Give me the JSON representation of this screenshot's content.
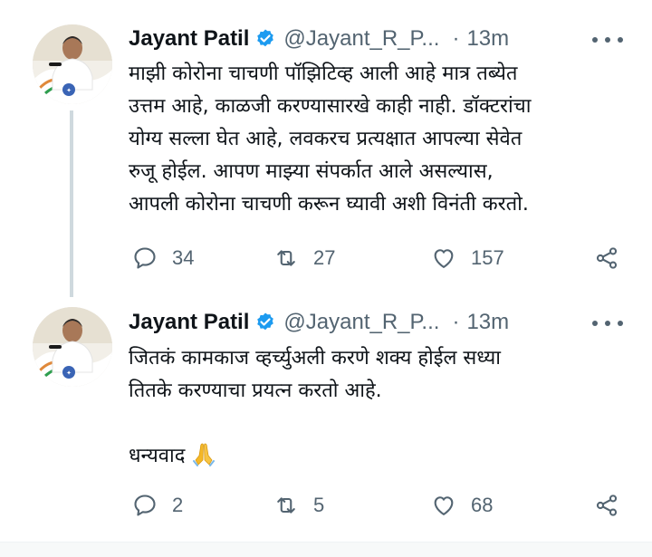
{
  "tweets": [
    {
      "author": {
        "name": "Jayant Patil",
        "handle": "@Jayant_R_P...",
        "verified": true
      },
      "time": "13m",
      "separator": "·",
      "text_lines": [
        "माझी कोरोना चाचणी पॉझिटिव्ह आली आहे मात्र तब्येत",
        "उत्तम आहे, काळजी करण्यासारखे काही नाही. डॉक्टरांचा",
        "योग्य सल्ला घेत आहे, लवकरच प्रत्यक्षात आपल्या सेवेत",
        "रुजू होईल. आपण माझ्या संपर्कात आले असल्यास,",
        "आपली कोरोना चाचणी करून घ्यावी अशी विनंती करतो."
      ],
      "replies": "34",
      "retweets": "27",
      "likes": "157"
    },
    {
      "author": {
        "name": "Jayant Patil",
        "handle": "@Jayant_R_P...",
        "verified": true
      },
      "time": "13m",
      "separator": "·",
      "text_lines": [
        "जितकं कामकाज व्हर्च्युअली करणे शक्य होईल सध्या",
        "तितके करण्याचा प्रयत्न करतो आहे.",
        "",
        "धन्यवाद"
      ],
      "emoji": "folded-hands",
      "replies": "2",
      "retweets": "5",
      "likes": "68"
    }
  ],
  "colors": {
    "text": "#0f1419",
    "secondary": "#536471",
    "verified": "#1d9bf0",
    "thread_line": "#cfd9de"
  },
  "icons": [
    "verified-badge-icon",
    "more-icon",
    "reply-icon",
    "retweet-icon",
    "like-icon",
    "share-icon",
    "folded-hands-emoji"
  ]
}
